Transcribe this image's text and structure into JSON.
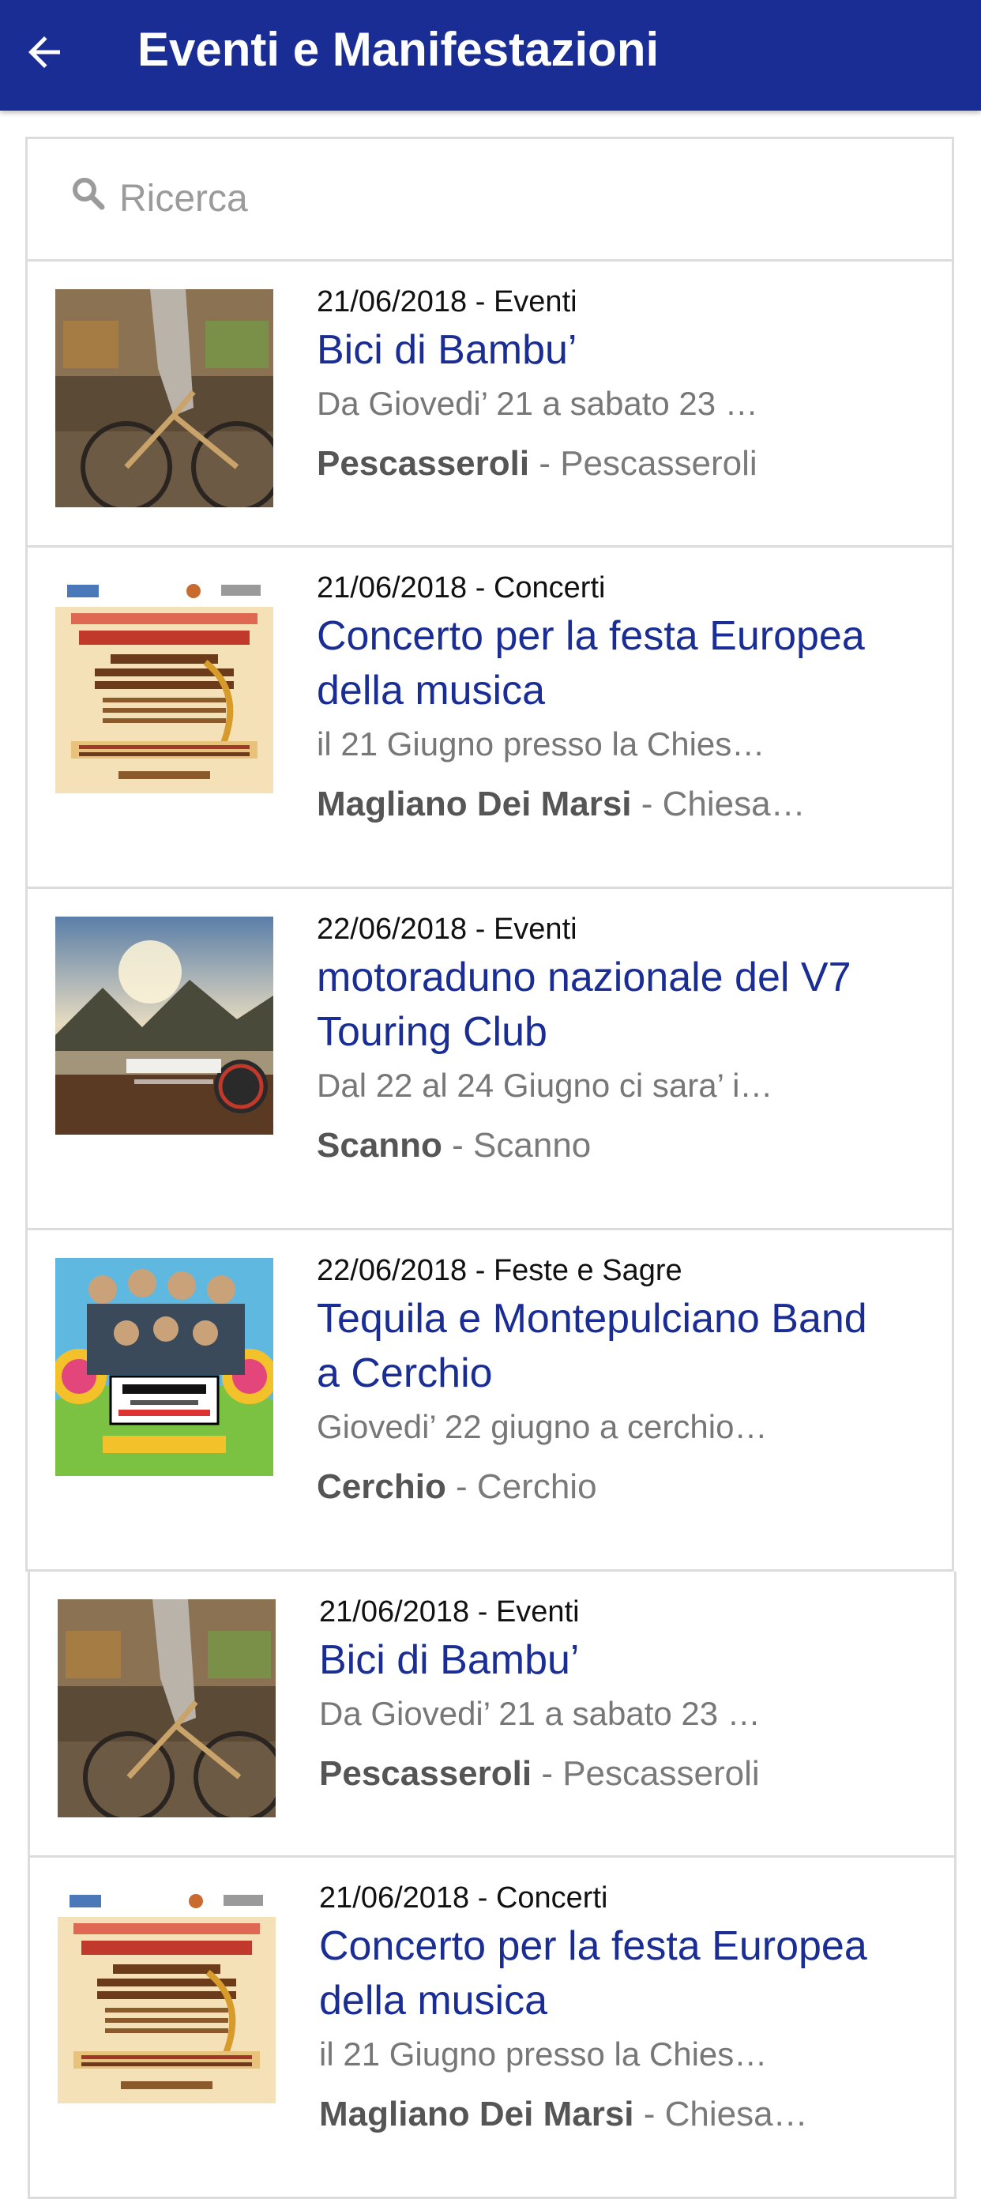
{
  "header": {
    "title": "Eventi e Manifestazioni",
    "back_icon": "arrow-left-icon"
  },
  "search": {
    "placeholder": "Ricerca",
    "value": "",
    "icon": "search-icon"
  },
  "colors": {
    "appbar": "#1a2d94",
    "title_link": "#1a2d94",
    "border": "#dcdcdc"
  },
  "events": [
    {
      "meta": "21/06/2018 - Eventi",
      "title": "Bici di Bambu’",
      "description": "Da Giovedi’ 21 a sabato 23 …",
      "place": "Pescasseroli",
      "address": " - Pescasseroli",
      "image": "bamboo-bike-photo"
    },
    {
      "meta": "21/06/2018 - Concerti",
      "title": "Concerto per la festa Europea della musica",
      "description": "il 21 Giugno presso la Chies…",
      "place": "Magliano Dei Marsi",
      "address": " - Chiesa…",
      "image": "concert-poster"
    },
    {
      "meta": "22/06/2018 - Eventi",
      "title": "motoraduno nazionale del V7 Touring Club",
      "description": "Dal 22 al 24 Giugno ci sara’ i…",
      "place": "Scanno",
      "address": " - Scanno",
      "image": "lake-landscape-photo"
    },
    {
      "meta": "22/06/2018 - Feste e Sagre",
      "title": "Tequila e Montepulciano Band a Cerchio",
      "description": "Giovedi’ 22 giugno a cerchio…",
      "place": "Cerchio",
      "address": " - Cerchio",
      "image": "band-poster"
    },
    {
      "meta": "21/06/2018 - Eventi",
      "title": "Bici di Bambu’",
      "description": "Da Giovedi’ 21 a sabato 23 …",
      "place": "Pescasseroli",
      "address": " - Pescasseroli",
      "image": "bamboo-bike-photo"
    },
    {
      "meta": "21/06/2018 - Concerti",
      "title": "Concerto per la festa Europea della musica",
      "description": "il 21 Giugno presso la Chies…",
      "place": "Magliano Dei Marsi",
      "address": " - Chiesa…",
      "image": "concert-poster"
    }
  ]
}
